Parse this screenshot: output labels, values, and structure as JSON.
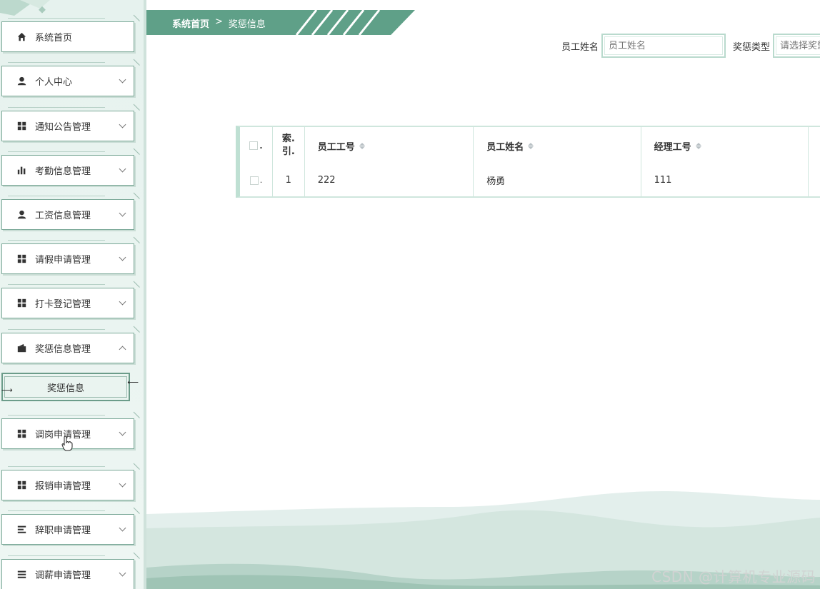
{
  "breadcrumb": {
    "home": "系统首页",
    "separator": ">",
    "current": "奖惩信息"
  },
  "search": {
    "name_label": "员工姓名",
    "name_placeholder": "员工姓名",
    "type_label": "奖惩类型",
    "type_placeholder": "请选择奖惩"
  },
  "sidebar": {
    "items": [
      {
        "label": "系统首页",
        "icon": "home-icon",
        "chevron": false
      },
      {
        "label": "个人中心",
        "icon": "user-icon",
        "chevron": true
      },
      {
        "label": "通知公告管理",
        "icon": "grid-icon",
        "chevron": true
      },
      {
        "label": "考勤信息管理",
        "icon": "bar-chart-icon",
        "chevron": true
      },
      {
        "label": "工资信息管理",
        "icon": "user-icon",
        "chevron": true
      },
      {
        "label": "请假申请管理",
        "icon": "grid-icon",
        "chevron": true
      },
      {
        "label": "打卡登记管理",
        "icon": "grid-icon",
        "chevron": true
      },
      {
        "label": "奖惩信息管理",
        "icon": "wallet-icon",
        "chevron": true,
        "expanded": true
      },
      {
        "label": "调岗申请管理",
        "icon": "grid-icon",
        "chevron": true
      },
      {
        "label": "报销申请管理",
        "icon": "grid-icon",
        "chevron": true
      },
      {
        "label": "辞职申请管理",
        "icon": "list-icon",
        "chevron": true
      },
      {
        "label": "调薪申请管理",
        "icon": "list-icon",
        "chevron": true
      }
    ],
    "sub_item": "奖惩信息"
  },
  "table": {
    "columns": [
      "索引",
      "员工工号",
      "员工姓名",
      "经理工号"
    ],
    "index_header_line1": "索.",
    "index_header_line2": "引.",
    "rows": [
      {
        "index": "1",
        "emp_no": "222",
        "emp_name": "杨勇",
        "manager_no": "111"
      }
    ]
  },
  "watermark": "CSDN @计算机专业源码",
  "colors": {
    "accent": "#5fa088",
    "sidebar_bg": "#e6f2ee",
    "border": "#cfe6dd"
  }
}
